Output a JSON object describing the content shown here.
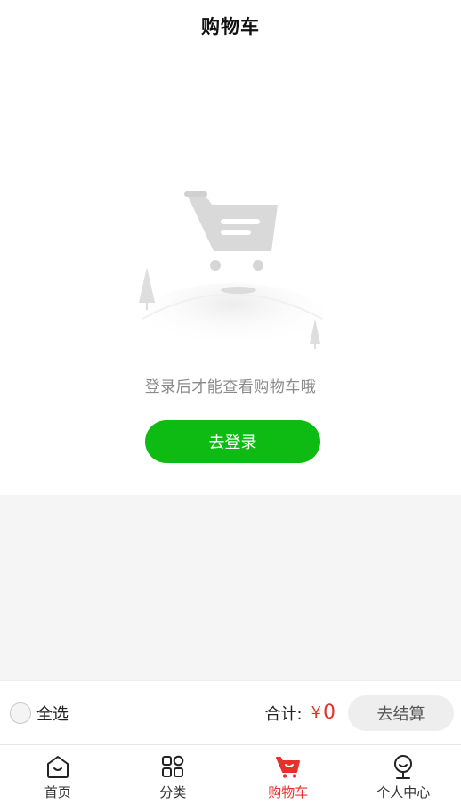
{
  "header": {
    "title": "购物车"
  },
  "empty_state": {
    "message": "登录后才能查看购物车哦",
    "login_button": "去登录",
    "illustration_icon": "empty-cart-icon"
  },
  "checkout": {
    "select_all_label": "全选",
    "total_label": "合计:",
    "currency": "¥",
    "total_value": "0",
    "checkout_button": "去结算"
  },
  "tabbar": {
    "items": [
      {
        "label": "首页",
        "icon": "home-icon",
        "active": false
      },
      {
        "label": "分类",
        "icon": "category-icon",
        "active": false
      },
      {
        "label": "购物车",
        "icon": "cart-icon",
        "active": true
      },
      {
        "label": "个人中心",
        "icon": "user-icon",
        "active": false
      }
    ]
  },
  "colors": {
    "accent_green": "#0dbb12",
    "price_red": "#e5312b",
    "background_grey": "#f5f5f5"
  }
}
